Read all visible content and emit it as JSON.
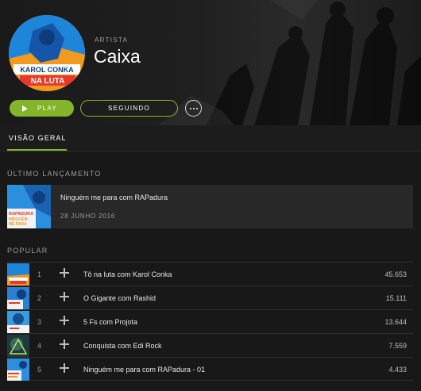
{
  "artist": {
    "kicker": "ARTISTA",
    "name": "Caixa",
    "avatar_text": [
      "KAROL CONKA",
      "NA LUTA"
    ]
  },
  "actions": {
    "play_label": "PLAY",
    "follow_label": "SEGUINDO",
    "more_icon": "ellipsis-icon"
  },
  "tabs": [
    {
      "label": "VISÃO GERAL",
      "active": true
    }
  ],
  "latest_release": {
    "section_label": "ÚLTIMO LANÇAMENTO",
    "title": "Ninguém me para com RAPadura",
    "date": "28 JUNHO 2016",
    "cover_text": [
      "RAPADURA",
      "NINGUÉM",
      "ME PARA"
    ]
  },
  "popular": {
    "section_label": "POPULAR",
    "tracks": [
      {
        "num": "1",
        "title": "Tô na luta com Karol Conka",
        "plays": "45.653"
      },
      {
        "num": "2",
        "title": "O Gigante com Rashid",
        "plays": "15.111"
      },
      {
        "num": "3",
        "title": "5 Fs com Projota",
        "plays": "13.644"
      },
      {
        "num": "4",
        "title": "Conquista com Edi Rock",
        "plays": "7.559"
      },
      {
        "num": "5",
        "title": "Ninguém me para com RAPadura - 01",
        "plays": "4.433"
      }
    ]
  },
  "colors": {
    "accent": "#84b429",
    "background": "#181818",
    "row_highlight": "#282828"
  }
}
